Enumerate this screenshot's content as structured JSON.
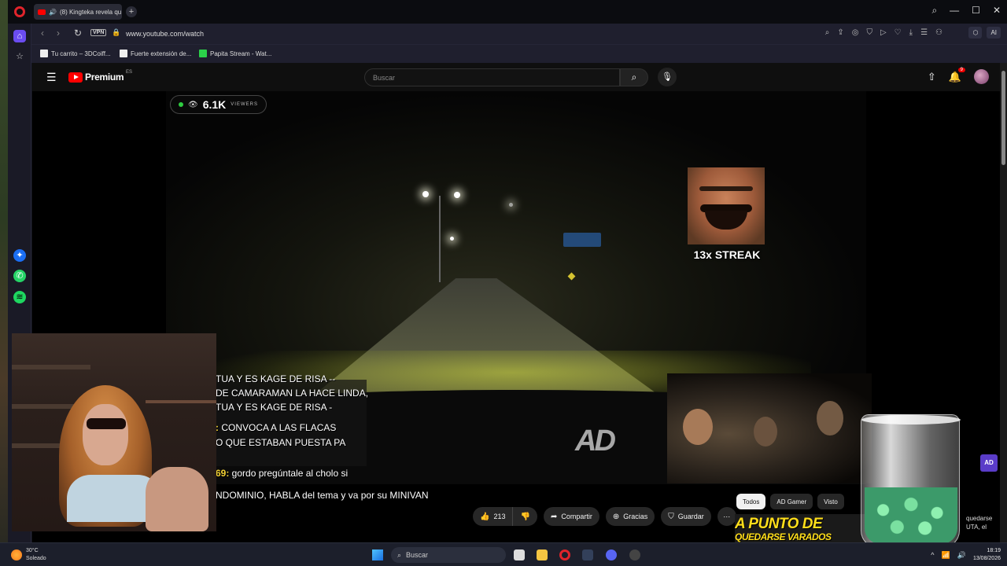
{
  "browser": {
    "tab_title": "(8) Kingteka revela qu...",
    "vpn_label": "VPN",
    "url": "www.youtube.com/watch",
    "ai_label": "AI",
    "bookmarks": [
      {
        "label": "Tu carrito – 3DCoiff..."
      },
      {
        "label": "Fuerte extensión de..."
      },
      {
        "label": "Papita Stream - Wat..."
      }
    ]
  },
  "youtube": {
    "logo_text": "Premium",
    "country_code": "ES",
    "search_placeholder": "Buscar",
    "notification_count": "9"
  },
  "stream": {
    "viewers_count": "6.1K",
    "viewers_label": "VIEWERS",
    "streak_text": "13x STREAK",
    "watermark": "AD",
    "chat_lines": [
      {
        "name": "",
        "text": "TUA Y ES KAGE DE RISA --"
      },
      {
        "name": "",
        "text": "DE CAMARAMAN LA HACE LINDA,"
      },
      {
        "name": "",
        "text": "TUA Y ES KAGE DE RISA -"
      },
      {
        "name": ":",
        "text": " CONVOCA A LAS FLACAS"
      },
      {
        "name": "",
        "text": "O QUE ESTABAN PUESTA PA"
      },
      {
        "name": "69:",
        "text": " gordo pregúntale al cholo si"
      },
      {
        "name": "",
        "text": "NDOMINIO, HABLA del tema y va por su MINIVAN"
      }
    ]
  },
  "actions": {
    "like_count": "213",
    "share_label": "Compartir",
    "thanks_label": "Gracias",
    "save_label": "Guardar"
  },
  "chips": [
    "Todos",
    "AD Gamer",
    "Visto"
  ],
  "recommendation": {
    "title": "A PUNTO DE",
    "subtitle": "QUEDARSE VARADOS",
    "side_text_1": "quedarse",
    "side_text_2": "UTA, el",
    "badge": "AD"
  },
  "taskbar": {
    "temperature": "30°C",
    "weather": "Soleado",
    "search_label": "Buscar",
    "time": "18:19",
    "date": "13/08/2026"
  }
}
